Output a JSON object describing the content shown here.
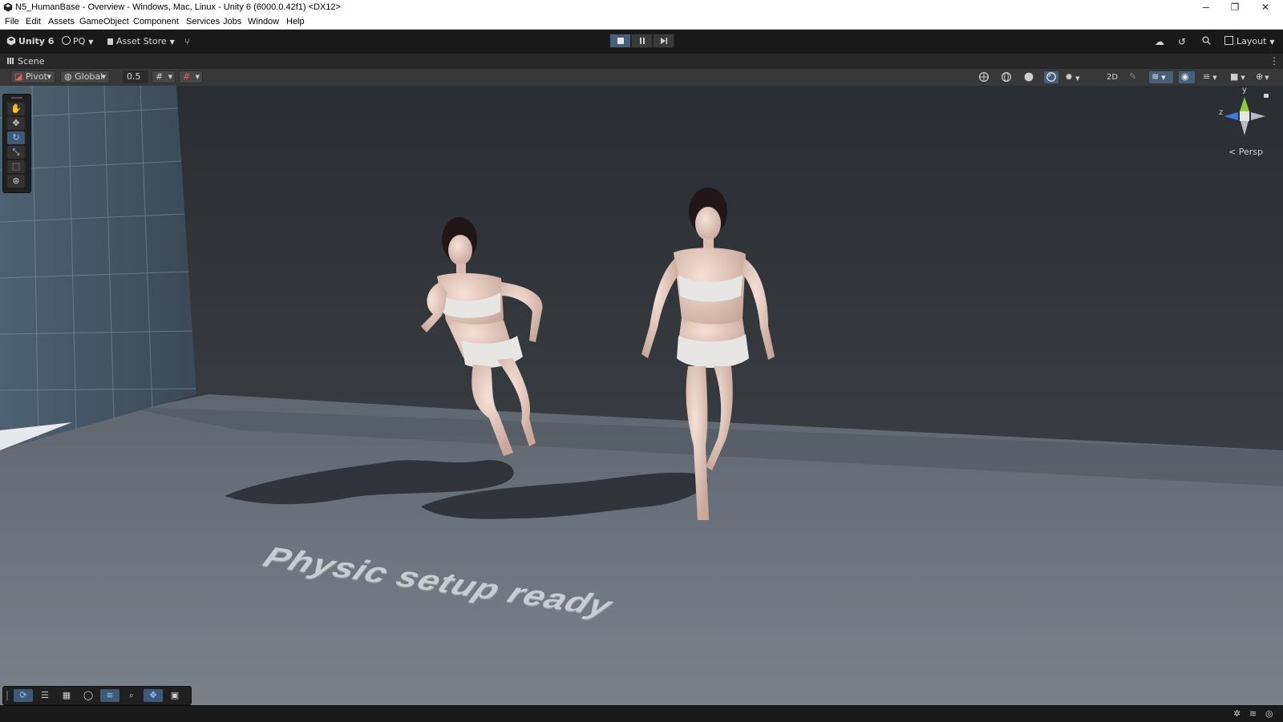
{
  "window": {
    "title": "N5_HumanBase - Overview - Windows, Mac, Linux - Unity 6 (6000.0.42f1) <DX12>",
    "controls": [
      "─",
      "❐",
      "✕"
    ]
  },
  "menu": [
    "File",
    "Edit",
    "Assets",
    "GameObject",
    "Component",
    "Services",
    "Jobs",
    "Window",
    "Help"
  ],
  "toolbar": {
    "unity_label": "Unity 6",
    "account_label": "PQ",
    "asset_store_label": "Asset Store",
    "layout_label": "Layout"
  },
  "scene_tab": {
    "label": "Scene"
  },
  "scene_toolbar": {
    "pivot_label": "Pivot",
    "global_label": "Global",
    "snap_value": "0.5"
  },
  "tools": [
    "hand-tool",
    "move-tool",
    "rotate-tool",
    "scale-tool",
    "rect-tool",
    "transform-tool"
  ],
  "gizmo": {
    "y_label": "y",
    "z_label": "z",
    "persp_label": "< Persp"
  },
  "scene_text": "Physic setup ready",
  "colors": {
    "accent": "#46607c",
    "gizmo_y": "#8ccd3a",
    "gizmo_z": "#3d7bdd"
  }
}
